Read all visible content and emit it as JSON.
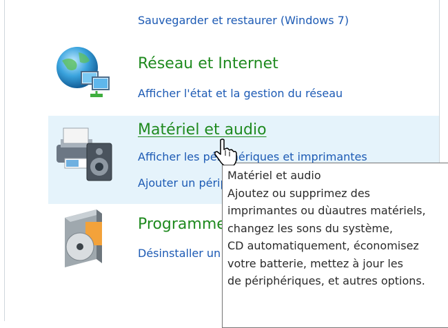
{
  "categories": [
    {
      "id": "system",
      "links": [
        "Sauvegarder et restaurer (Windows 7)"
      ]
    },
    {
      "id": "network",
      "title": "Réseau et Internet",
      "links": [
        "Afficher l'état et la gestion du réseau"
      ]
    },
    {
      "id": "hardware",
      "title": "Matériel et audio",
      "links": [
        "Afficher les périphériques et imprimantes",
        "Ajouter un périphérique"
      ]
    },
    {
      "id": "programs",
      "title": "Programmes",
      "links": [
        "Désinstaller un programme"
      ]
    }
  ],
  "tooltip": {
    "lines": [
      "Matériel et audio",
      "Ajoutez ou supprimez des",
      "imprimantes ou dùautres matériels,",
      "changez les sons du système,",
      "CD automatiquement, économisez",
      "votre batterie, mettez à jour les",
      "de périphériques, et autres options."
    ]
  },
  "icons": {
    "network": "globe-network-icon",
    "hardware": "printer-speaker-icon",
    "programs": "program-box-icon",
    "cursor": "hand-pointer-cursor-icon"
  },
  "colors": {
    "link": "#1c5ab4",
    "heading": "#1f8a1f",
    "hover_band": "#e5f3fb"
  }
}
